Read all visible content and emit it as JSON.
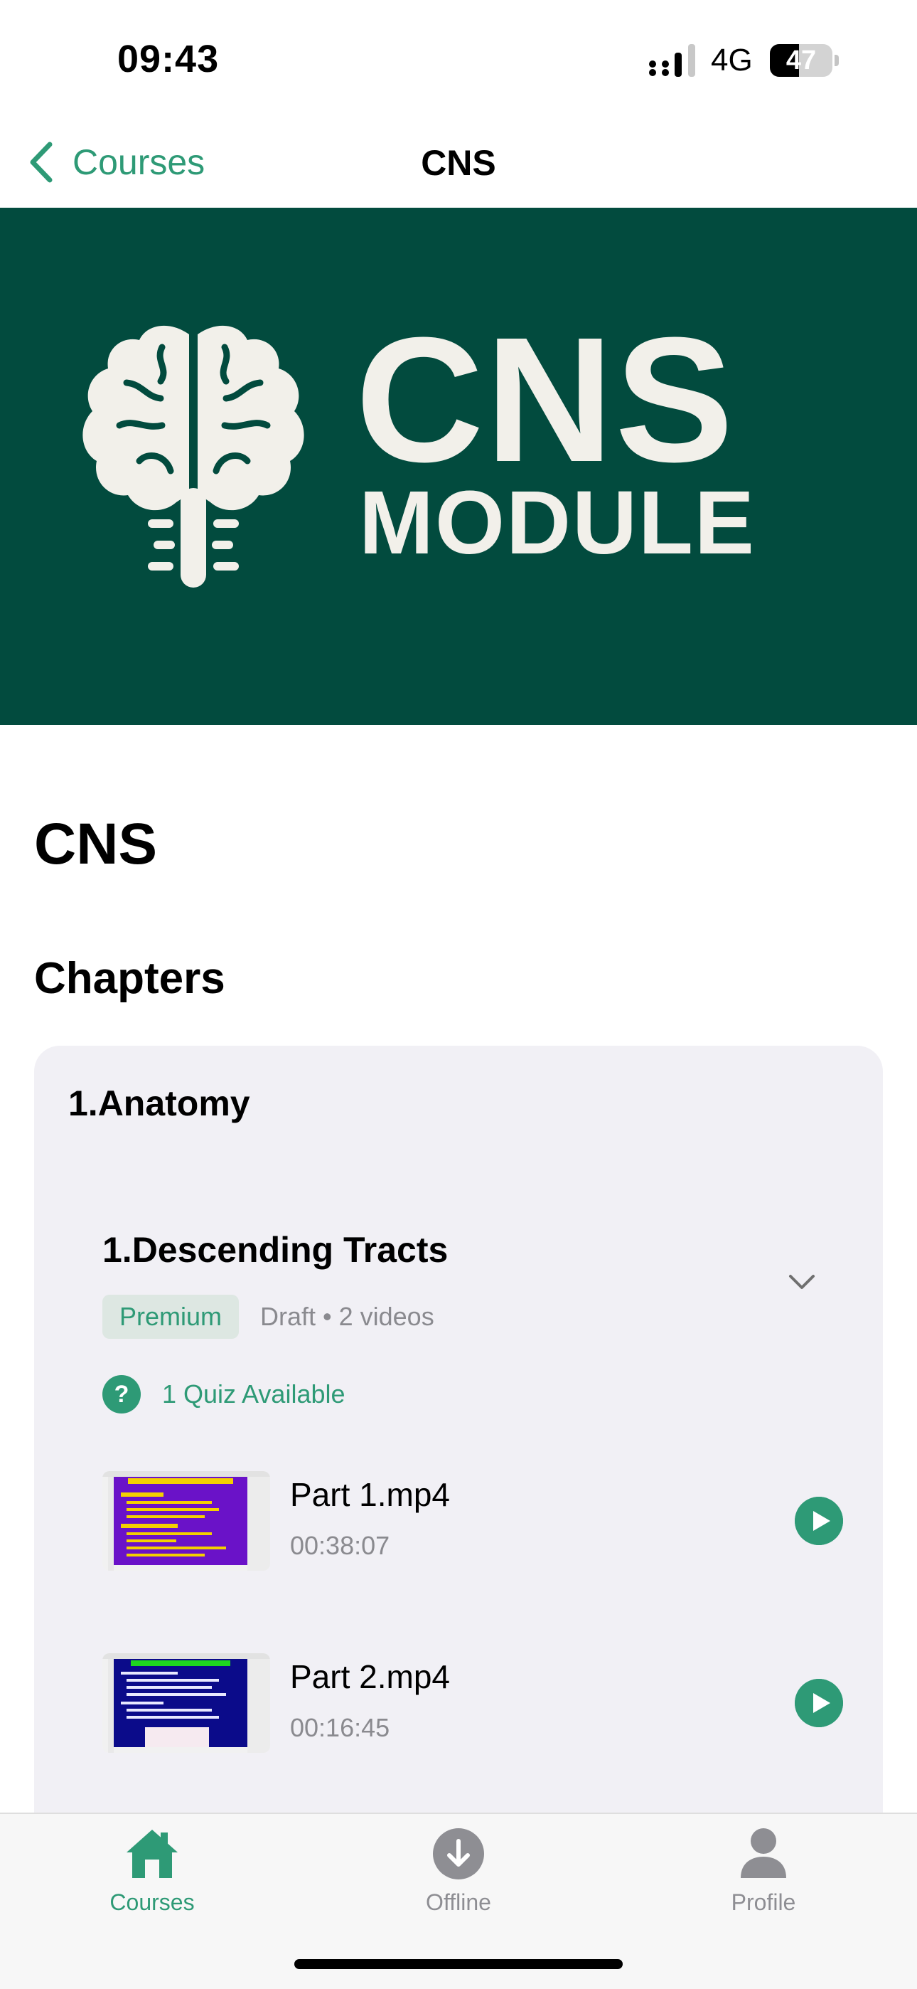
{
  "status_bar": {
    "time": "09:43",
    "network": "4G",
    "battery_percent": "47",
    "battery_level": 0.47
  },
  "nav": {
    "back_label": "Courses",
    "title": "CNS"
  },
  "hero": {
    "title": "CNS",
    "subtitle": "MODULE",
    "background_color": "#024b3e",
    "logo_icon": "brain-icon"
  },
  "course": {
    "title": "CNS",
    "chapters_heading": "Chapters"
  },
  "chapters": [
    {
      "title": "1.Anatomy",
      "lessons": [
        {
          "title": "1.Descending Tracts",
          "badge": "Premium",
          "meta": "Draft • 2 videos",
          "quiz": "1 Quiz Available",
          "videos": [
            {
              "name": "Part 1.mp4",
              "duration": "00:38:07"
            },
            {
              "name": "Part 2.mp4",
              "duration": "00:16:45"
            }
          ]
        }
      ]
    }
  ],
  "tabs": [
    {
      "label": "Courses",
      "icon": "home-icon",
      "active": true
    },
    {
      "label": "Offline",
      "icon": "download-icon",
      "active": false
    },
    {
      "label": "Profile",
      "icon": "person-icon",
      "active": false
    }
  ],
  "colors": {
    "accent": "#2e9a76",
    "inactive": "#8e8e93",
    "card_background": "#f1f0f5"
  }
}
